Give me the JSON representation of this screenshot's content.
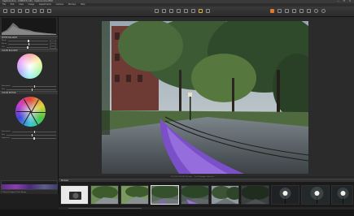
{
  "app": {
    "title": "Capture One - CORVICS (16) - Capture One PRO",
    "window_controls": "— ❐ ✕"
  },
  "menu": [
    "File",
    "Edit",
    "View",
    "Image",
    "Adjustments",
    "Camera",
    "Window",
    "Help"
  ],
  "left_panel": {
    "section_white_balance": "WHITE BALANCE",
    "section_color_editor": "COLOR EDITOR",
    "section_color_balance": "COLOR BALANCE",
    "rows": [
      {
        "label": "Mode"
      },
      {
        "label": "Kelvin"
      },
      {
        "label": "Tint"
      }
    ],
    "row_labels_balance": [
      "Saturation",
      "Hue",
      "Lightness"
    ],
    "checkbox_label": "Show Unclipped Color Range"
  },
  "viewer": {
    "status": "ISO 100  1/25  f/8.0  35 mm",
    "path": "1 of 16 Images Selected"
  },
  "browser": {
    "title": "Browser"
  },
  "colors": {
    "accent": "#e07a2a",
    "panel_bg": "#2a2a2a",
    "viewer_bg": "#2b2b2b",
    "filmstrip_bg": "#1a1a1a"
  },
  "thumbnails": [
    {
      "scene": "camera-product"
    },
    {
      "scene": "park-green"
    },
    {
      "scene": "park-green"
    },
    {
      "scene": "park-path",
      "selected": true
    },
    {
      "scene": "park-path-purple"
    },
    {
      "scene": "park-trees"
    },
    {
      "scene": "dark-park"
    },
    {
      "scene": "lamp-night"
    },
    {
      "scene": "lamp-night"
    },
    {
      "scene": "lamp-night"
    }
  ]
}
